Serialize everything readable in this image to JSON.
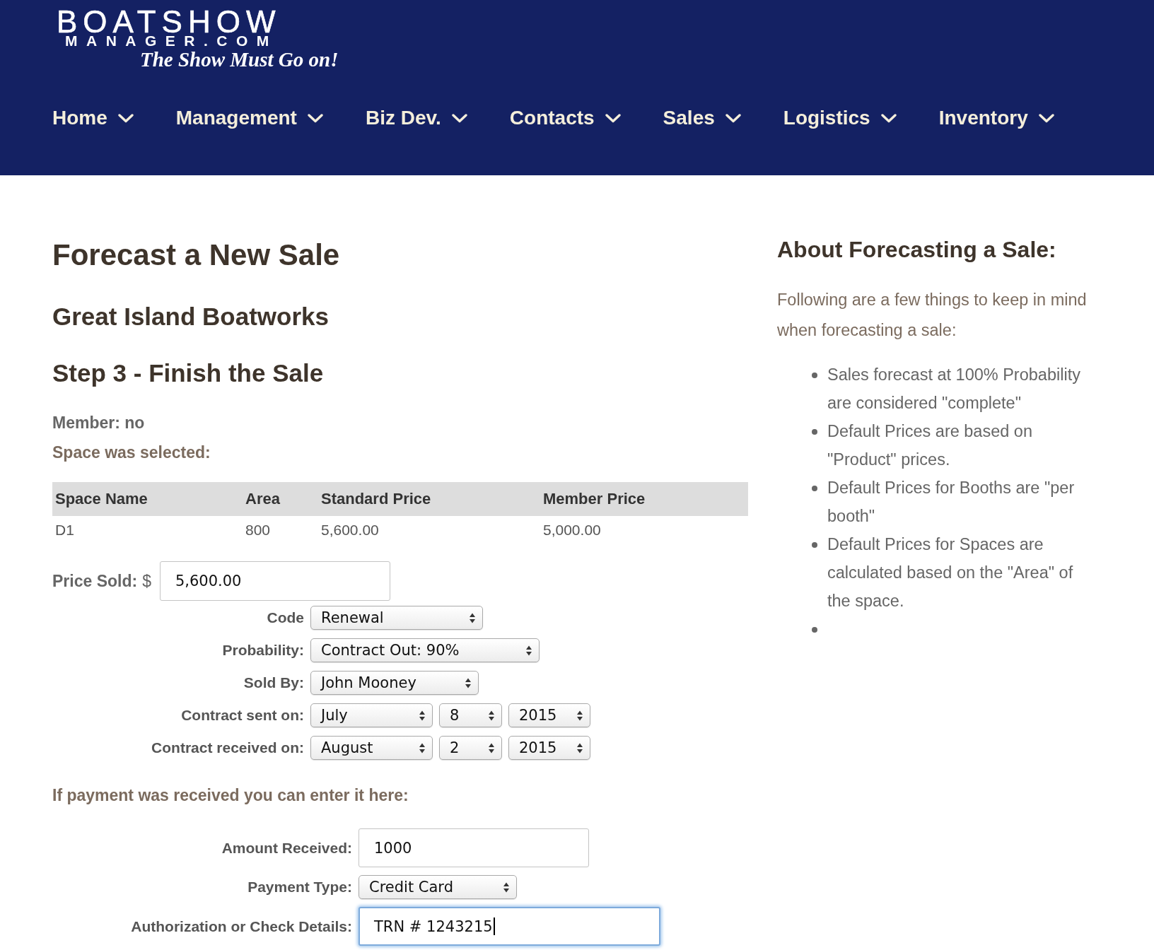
{
  "header": {
    "logo": {
      "wordmark": "BOATSHOW",
      "subtitle": "MANAGER.COM",
      "tagline": "The Show Must Go on!"
    },
    "nav": [
      {
        "label": "Home"
      },
      {
        "label": "Management"
      },
      {
        "label": "Biz Dev."
      },
      {
        "label": "Contacts"
      },
      {
        "label": "Sales"
      },
      {
        "label": "Logistics"
      },
      {
        "label": "Inventory"
      }
    ]
  },
  "main": {
    "title": "Forecast a New Sale",
    "company": "Great Island Boatworks",
    "step": "Step 3 - Finish the Sale",
    "member": "Member: no",
    "space_note": "Space was selected:",
    "table": {
      "columns": [
        "Space Name",
        "Area",
        "Standard Price",
        "Member Price"
      ],
      "rows": [
        [
          "D1",
          "800",
          "5,600.00",
          "5,000.00"
        ]
      ]
    },
    "price_sold": {
      "label": "Price Sold:",
      "currency": "$",
      "value": "5,600.00"
    },
    "fields": [
      {
        "kind": "select",
        "label": "Code",
        "value": "Renewal"
      },
      {
        "kind": "select",
        "label": "Probability:",
        "value": "Contract Out: 90%"
      },
      {
        "kind": "select",
        "label": "Sold By:",
        "value": "John Mooney"
      },
      {
        "kind": "date",
        "label": "Contract sent on:",
        "month": "July",
        "day": "8",
        "year": "2015"
      },
      {
        "kind": "date",
        "label": "Contract received on:",
        "month": "August",
        "day": "2",
        "year": "2015"
      }
    ],
    "payment_note": "If payment was received you can enter it here:",
    "payment_fields": [
      {
        "kind": "text",
        "label": "Amount Received:",
        "value": "1000",
        "focused": false
      },
      {
        "kind": "select",
        "label": "Payment Type:",
        "value": "Credit Card"
      },
      {
        "kind": "text",
        "label": "Authorization or Check Details:",
        "value": "TRN # 1243215",
        "focused": true
      }
    ]
  },
  "sidebar": {
    "title": "About Forecasting a Sale:",
    "intro": "Following are a few things to keep in mind when forecasting a sale:",
    "tips": [
      {
        "kind": "text",
        "text": "Sales forecast at 100% Probability are considered \"complete\""
      },
      {
        "kind": "text",
        "text": "Default Prices are based on \"Product\" prices."
      },
      {
        "kind": "text",
        "text": "Default Prices for Booths are \"per booth\""
      },
      {
        "kind": "text",
        "text": "Default Prices for Spaces are calculated based on the \"Area\" of the space."
      },
      {
        "kind": "empty"
      }
    ]
  }
}
